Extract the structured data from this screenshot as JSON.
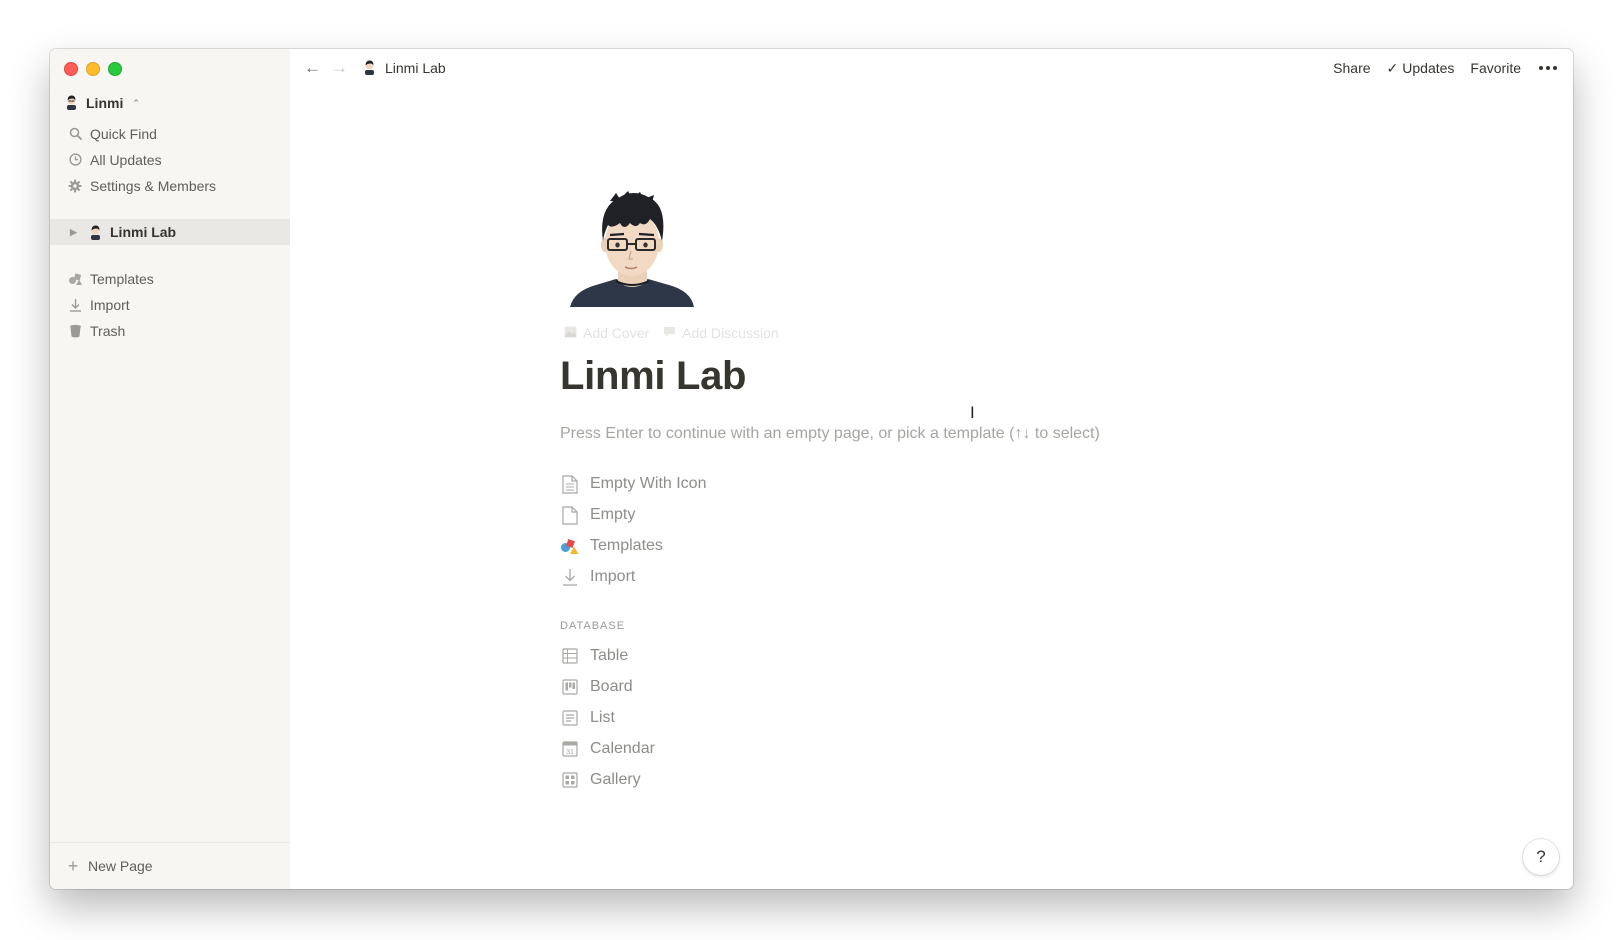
{
  "sidebar": {
    "workspace": "Linmi",
    "items": [
      {
        "label": "Quick Find",
        "icon": "search-icon"
      },
      {
        "label": "All Updates",
        "icon": "clock-icon"
      },
      {
        "label": "Settings & Members",
        "icon": "gear-icon"
      }
    ],
    "pages": [
      {
        "label": "Linmi Lab",
        "icon": "avatar-icon",
        "active": true
      }
    ],
    "bottom_items": [
      {
        "label": "Templates",
        "icon": "templates-icon"
      },
      {
        "label": "Import",
        "icon": "import-icon"
      },
      {
        "label": "Trash",
        "icon": "trash-icon"
      }
    ],
    "new_page": "New Page"
  },
  "topbar": {
    "breadcrumb": "Linmi Lab",
    "share": "Share",
    "updates": "Updates",
    "favorite": "Favorite"
  },
  "page": {
    "add_cover": "Add Cover",
    "add_discussion": "Add Discussion",
    "title": "Linmi Lab",
    "hint": "Press Enter to continue with an empty page, or pick a template (↑↓ to select)",
    "templates": [
      {
        "label": "Empty With Icon",
        "icon": "document-lines-icon"
      },
      {
        "label": "Empty",
        "icon": "document-icon"
      },
      {
        "label": "Templates",
        "icon": "templates-icon"
      },
      {
        "label": "Import",
        "icon": "import-icon"
      }
    ],
    "database_label": "DATABASE",
    "databases": [
      {
        "label": "Table",
        "icon": "table-icon"
      },
      {
        "label": "Board",
        "icon": "board-icon"
      },
      {
        "label": "List",
        "icon": "list-icon"
      },
      {
        "label": "Calendar",
        "icon": "calendar-icon"
      },
      {
        "label": "Gallery",
        "icon": "gallery-icon"
      }
    ]
  },
  "help": "?"
}
